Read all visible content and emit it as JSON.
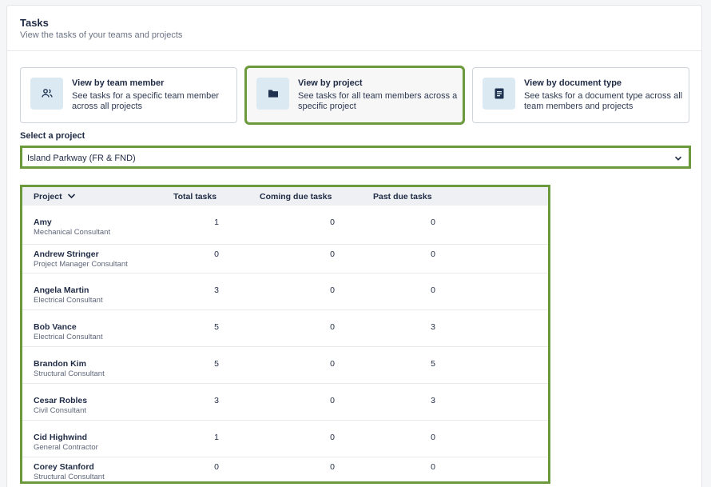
{
  "header": {
    "title": "Tasks",
    "subtitle": "View the tasks of your teams and projects"
  },
  "view_cards": [
    {
      "title": "View by team member",
      "description": "See tasks for a specific team member across all projects",
      "icon": "people-icon",
      "selected": false
    },
    {
      "title": "View by project",
      "description": "See tasks for all team members across a specific project",
      "icon": "folder-icon",
      "selected": true
    },
    {
      "title": "View by document type",
      "description": "See tasks for a document type across all team members and projects",
      "icon": "document-icon",
      "selected": false
    }
  ],
  "project_select": {
    "label": "Select a project",
    "value": "Island Parkway (FR & FND)"
  },
  "table": {
    "columns": [
      "Project",
      "Total tasks",
      "Coming due tasks",
      "Past due tasks"
    ],
    "rows": [
      {
        "name": "Amy",
        "role": "Mechanical Consultant",
        "total": "1",
        "coming": "0",
        "past": "0"
      },
      {
        "name": "Andrew Stringer",
        "role": "Project Manager Consultant",
        "total": "0",
        "coming": "0",
        "past": "0"
      },
      {
        "name": "Angela Martin",
        "role": "Electrical Consultant",
        "total": "3",
        "coming": "0",
        "past": "0"
      },
      {
        "name": "Bob Vance",
        "role": "Electrical Consultant",
        "total": "5",
        "coming": "0",
        "past": "3"
      },
      {
        "name": "Brandon Kim",
        "role": "Structural Consultant",
        "total": "5",
        "coming": "0",
        "past": "5"
      },
      {
        "name": "Cesar Robles",
        "role": "Civil Consultant",
        "total": "3",
        "coming": "0",
        "past": "3"
      },
      {
        "name": "Cid Highwind",
        "role": "General Contractor",
        "total": "1",
        "coming": "0",
        "past": "0"
      },
      {
        "name": "Corey Stanford",
        "role": "Structural Consultant",
        "total": "0",
        "coming": "0",
        "past": "0"
      }
    ]
  },
  "colors": {
    "highlight": "#6a9a3c",
    "icon_bg": "#dbe9f3",
    "text": "#1f2a44"
  }
}
